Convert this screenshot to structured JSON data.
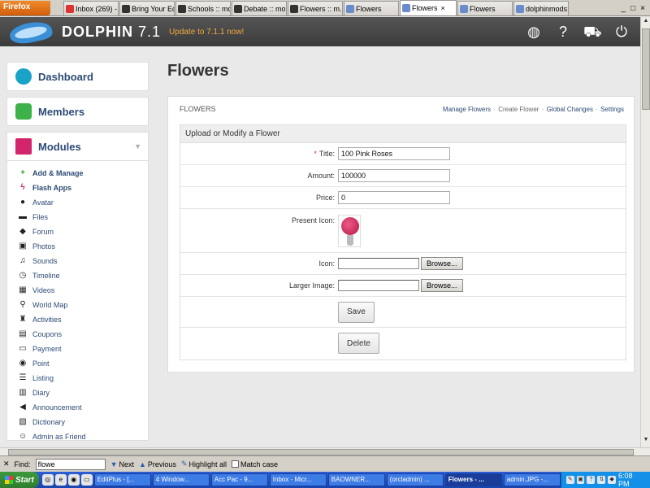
{
  "browser": {
    "menu_button": "Firefox",
    "tabs": [
      {
        "label": "Inbox (269) -...",
        "fav": "gm"
      },
      {
        "label": "Bring Your Ed...",
        "fav": ""
      },
      {
        "label": "Schools :: mo...",
        "fav": ""
      },
      {
        "label": "Debate :: mo...",
        "fav": ""
      },
      {
        "label": "Flowers :: m...",
        "fav": ""
      },
      {
        "label": "Flowers",
        "fav": "fl"
      },
      {
        "label": "Flowers",
        "fav": "fl",
        "active": true
      },
      {
        "label": "Flowers",
        "fav": "fl"
      },
      {
        "label": "dolphinmods:...",
        "fav": "fl"
      }
    ],
    "close_tab_glyph": "×"
  },
  "header": {
    "brand": "DOLPHIN",
    "version": "7.1",
    "update_link": "Update to 7.1.1 now!",
    "icons": [
      "globe-icon",
      "help-icon",
      "cart-icon",
      "power-icon"
    ]
  },
  "sidebar": {
    "dashboard": "Dashboard",
    "members": "Members",
    "modules": "Modules",
    "items": [
      {
        "label": "Add & Manage",
        "icon": "plus-icon",
        "glyph": "+",
        "style": "green",
        "bold": true
      },
      {
        "label": "Flash Apps",
        "icon": "flash-icon",
        "glyph": "ϟ",
        "style": "pink",
        "bold": true
      },
      {
        "label": "Avatar",
        "icon": "person-icon",
        "glyph": "●"
      },
      {
        "label": "Files",
        "icon": "files-icon",
        "glyph": "▬"
      },
      {
        "label": "Forum",
        "icon": "chat-icon",
        "glyph": "◆"
      },
      {
        "label": "Photos",
        "icon": "picture-icon",
        "glyph": "▣"
      },
      {
        "label": "Sounds",
        "icon": "music-icon",
        "glyph": "♫"
      },
      {
        "label": "Timeline",
        "icon": "clock-icon",
        "glyph": "◷"
      },
      {
        "label": "Videos",
        "icon": "film-icon",
        "glyph": "▦"
      },
      {
        "label": "World Map",
        "icon": "map-marker-icon",
        "glyph": "⚲"
      },
      {
        "label": "Activities",
        "icon": "activity-icon",
        "glyph": "♜"
      },
      {
        "label": "Coupons",
        "icon": "coupon-icon",
        "glyph": "▤"
      },
      {
        "label": "Payment",
        "icon": "payment-icon",
        "glyph": "▭"
      },
      {
        "label": "Point",
        "icon": "point-icon",
        "glyph": "◉"
      },
      {
        "label": "Listing",
        "icon": "list-icon",
        "glyph": "☰"
      },
      {
        "label": "Diary",
        "icon": "diary-icon",
        "glyph": "▥"
      },
      {
        "label": "Announcement",
        "icon": "megaphone-icon",
        "glyph": "◀"
      },
      {
        "label": "Dictionary",
        "icon": "book-icon",
        "glyph": "▧"
      },
      {
        "label": "Admin as Friend",
        "icon": "friend-icon",
        "glyph": "☺"
      }
    ]
  },
  "main": {
    "page_title": "Flowers",
    "panel_title": "FLOWERS",
    "links": {
      "manage": "Manage Flowers",
      "create": "Create Flower",
      "global": "Global Changes",
      "settings": "Settings",
      "separator": "·"
    },
    "form": {
      "heading": "Upload or Modify a Flower",
      "required_mark": "*",
      "title_label": "Title:",
      "title_value": "100 Pink Roses",
      "amount_label": "Amount:",
      "amount_value": "100000",
      "price_label": "Price:",
      "price_value": "0",
      "present_icon_label": "Present Icon:",
      "icon_label": "Icon:",
      "larger_image_label": "Larger Image:",
      "browse_label": "Browse...",
      "save_label": "Save",
      "delete_label": "Delete"
    }
  },
  "findbar": {
    "label": "Find:",
    "query": "flowe",
    "next": "Next",
    "previous": "Previous",
    "highlight": "Highlight all",
    "match_case": "Match case"
  },
  "taskbar": {
    "start": "Start",
    "items": [
      {
        "label": "EditPlus - [..."
      },
      {
        "label": "4 Window..."
      },
      {
        "label": "Acc Pac - 9..."
      },
      {
        "label": "Inbox - Micr..."
      },
      {
        "label": "BAOWNER..."
      },
      {
        "label": "(orcladmin) ..."
      },
      {
        "label": "Flowers - ...",
        "active": true
      },
      {
        "label": "admin.JPG -..."
      }
    ],
    "clock": "6:08 PM"
  }
}
